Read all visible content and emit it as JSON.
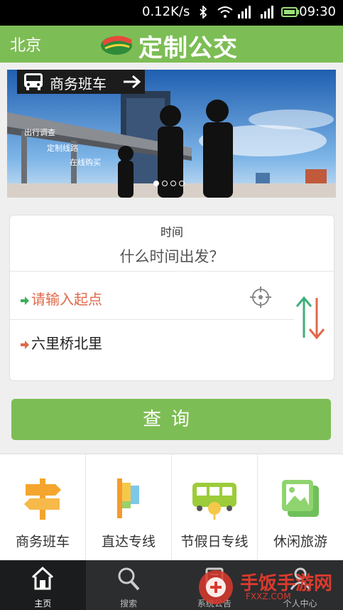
{
  "status_bar": {
    "network_speed": "0.12K/s",
    "time": "09:30",
    "icons": [
      "bluetooth-icon",
      "wifi-icon",
      "signal-icon",
      "signal-icon",
      "battery-icon"
    ]
  },
  "header": {
    "city": "北京",
    "title": "定制公交",
    "brand_color": "#7dbd55"
  },
  "banner": {
    "badge_label": "商务班车",
    "captions": [
      "出行调查",
      "定制线路",
      "在线购买"
    ],
    "active_index": 0,
    "page_count": 4
  },
  "trip_form": {
    "time_label": "时间",
    "time_placeholder": "什么时间出发？",
    "start_placeholder": "请输入起点",
    "end_value": "六里桥北里"
  },
  "query_button": {
    "label": "查询"
  },
  "categories": [
    {
      "label": "商务班车",
      "icon": "signpost-icon"
    },
    {
      "label": "直达专线",
      "icon": "flag-icon"
    },
    {
      "label": "节假日专线",
      "icon": "bus-icon"
    },
    {
      "label": "休闲旅游",
      "icon": "photo-icon"
    }
  ],
  "tabs": [
    {
      "label": "主页",
      "icon": "home-icon",
      "active": true
    },
    {
      "label": "搜索",
      "icon": "search-icon",
      "active": false
    },
    {
      "label": "系统公告",
      "icon": "notice-icon",
      "active": false
    },
    {
      "label": "个人中心",
      "icon": "user-icon",
      "active": false
    }
  ],
  "watermark": {
    "title": "手饭手游网",
    "subtitle": "FXXZ.COM"
  }
}
